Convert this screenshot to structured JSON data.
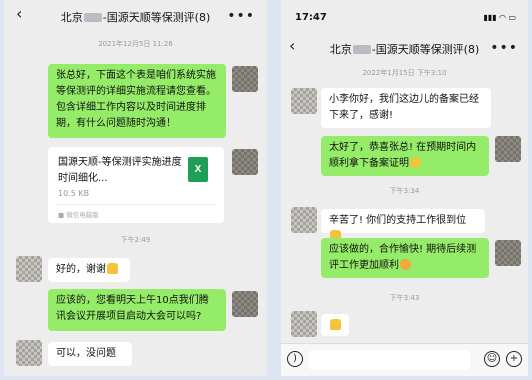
{
  "left": {
    "title_prefix": "北京",
    "title_suffix": "-国源天顺等保测评(8)",
    "back": "‹",
    "more": "•••",
    "ts1": "2021年12月5日 11:26",
    "msg1": "张总好，下面这个表是咱们系统实施等保测评的详细实施流程请您查看。包含详细工作内容以及时间进度排期，有什么问题随时沟通！",
    "file_title": "国源天顺-等保测评实施进度时间细化...",
    "file_size": "10.5 KB",
    "file_source": "微信电脑版",
    "file_icon": "X",
    "ts2": "下午2:49",
    "msg2": "好的，谢谢",
    "msg3": "应该的，您看明天上午10点我们腾讯会议开展项目启动大会可以吗?",
    "msg4": "可以，没问题"
  },
  "right": {
    "time": "17:47",
    "title_prefix": "北京",
    "title_suffix": "-国源天顺等保测评(8)",
    "back": "‹",
    "more": "•••",
    "ts1": "2022年1月15日 下午3:10",
    "msg1": "小李你好，我们这边儿的备案已经下来了，感谢!",
    "msg2": "太好了，恭喜张总! 在预期时间内顺利拿下备案证明",
    "ts2": "下午3:34",
    "msg3": "辛苦了! 你们的支持工作很到位",
    "msg4": "应该做的，合作愉快! 期待后续测评工作更加顺利",
    "ts3": "下午3:43",
    "input_icons": {
      "voice": "voice-icon",
      "emoji": "emoji-icon",
      "plus": "plus-icon"
    }
  }
}
